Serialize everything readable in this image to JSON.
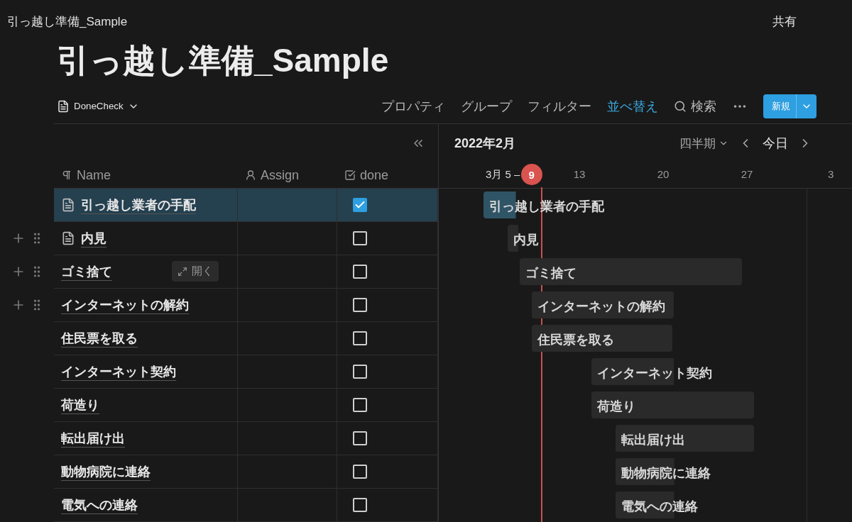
{
  "breadcrumb": "引っ越し準備_Sample",
  "share": "共有",
  "title": "引っ越し準備_Sample",
  "view": {
    "name": "DoneCheck"
  },
  "toolbar": [
    {
      "label": "プロパティ",
      "selected": false
    },
    {
      "label": "グループ",
      "selected": false
    },
    {
      "label": "フィルター",
      "selected": false
    },
    {
      "label": "並べ替え",
      "selected": true
    }
  ],
  "search": "検索",
  "new_button": "新規",
  "columns": [
    {
      "label": "Name",
      "kind": "title"
    },
    {
      "label": "Assign",
      "kind": "person"
    },
    {
      "label": "done",
      "kind": "checkbox"
    }
  ],
  "timeline": {
    "month": "2022年2月",
    "zoom": "四半期",
    "today": "今日",
    "range_label": "3月 5 –",
    "today_date": "9",
    "ticks": [
      "13",
      "20",
      "27",
      "3"
    ]
  },
  "rows": [
    {
      "name": "引っ越し業者の手配",
      "bar_label": "引っ越し業者の手配",
      "page_icon": true,
      "done": true,
      "selected": true,
      "handles": false
    },
    {
      "name": "内見",
      "bar_label": "内見",
      "page_icon": true,
      "done": false,
      "selected": false,
      "handles": true
    },
    {
      "name": "ゴミ捨て",
      "bar_label": "ゴミ捨て",
      "page_icon": false,
      "done": false,
      "selected": false,
      "handles": true,
      "open_button": "開く"
    },
    {
      "name": "インターネットの解約",
      "bar_label": "インターネットの解約",
      "page_icon": false,
      "done": false,
      "selected": false,
      "handles": true
    },
    {
      "name": "住民票を取る",
      "bar_label": "住民票を取る",
      "page_icon": false,
      "done": false,
      "selected": false,
      "handles": false
    },
    {
      "name": "インターネット契約",
      "bar_label": "インターネット契約",
      "page_icon": false,
      "done": false,
      "selected": false,
      "handles": false
    },
    {
      "name": "荷造り",
      "bar_label": "荷造り",
      "page_icon": false,
      "done": false,
      "selected": false,
      "handles": false
    },
    {
      "name": "転出届け出",
      "bar_label": "転出届け出",
      "page_icon": false,
      "done": false,
      "selected": false,
      "handles": false
    },
    {
      "name": "動物病院に連絡",
      "bar_label": "動物病院に連絡",
      "page_icon": false,
      "done": false,
      "selected": false,
      "handles": false
    },
    {
      "name": "電気への連絡",
      "bar_label": "電気への連絡",
      "page_icon": false,
      "done": false,
      "selected": false,
      "handles": false
    }
  ]
}
